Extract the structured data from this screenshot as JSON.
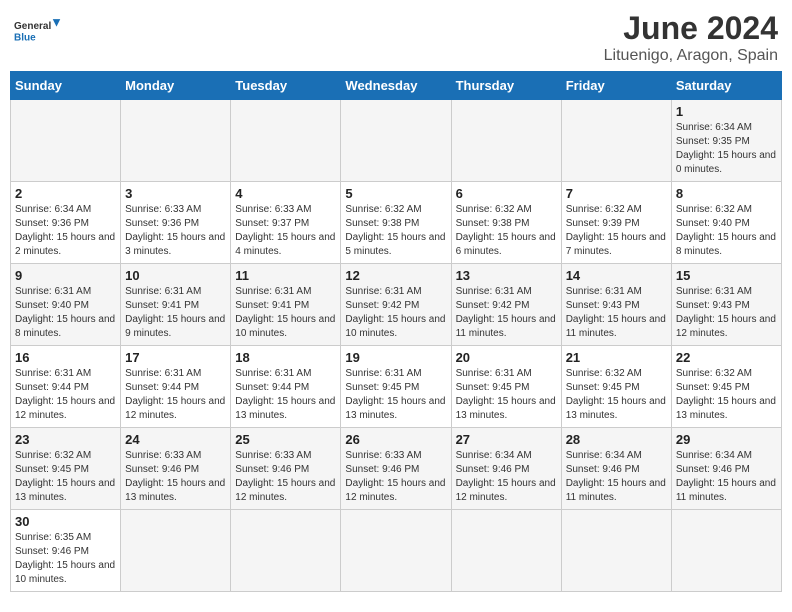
{
  "header": {
    "logo_general": "General",
    "logo_blue": "Blue",
    "title": "June 2024",
    "location": "Lituenigo, Aragon, Spain"
  },
  "days_of_week": [
    "Sunday",
    "Monday",
    "Tuesday",
    "Wednesday",
    "Thursday",
    "Friday",
    "Saturday"
  ],
  "weeks": [
    [
      {
        "day": "",
        "info": ""
      },
      {
        "day": "",
        "info": ""
      },
      {
        "day": "",
        "info": ""
      },
      {
        "day": "",
        "info": ""
      },
      {
        "day": "",
        "info": ""
      },
      {
        "day": "",
        "info": ""
      },
      {
        "day": "1",
        "info": "Sunrise: 6:34 AM\nSunset: 9:35 PM\nDaylight: 15 hours\nand 0 minutes."
      }
    ],
    [
      {
        "day": "2",
        "info": "Sunrise: 6:34 AM\nSunset: 9:36 PM\nDaylight: 15 hours\nand 2 minutes."
      },
      {
        "day": "3",
        "info": "Sunrise: 6:33 AM\nSunset: 9:36 PM\nDaylight: 15 hours\nand 3 minutes."
      },
      {
        "day": "4",
        "info": "Sunrise: 6:33 AM\nSunset: 9:37 PM\nDaylight: 15 hours\nand 4 minutes."
      },
      {
        "day": "5",
        "info": "Sunrise: 6:32 AM\nSunset: 9:38 PM\nDaylight: 15 hours\nand 5 minutes."
      },
      {
        "day": "6",
        "info": "Sunrise: 6:32 AM\nSunset: 9:38 PM\nDaylight: 15 hours\nand 6 minutes."
      },
      {
        "day": "7",
        "info": "Sunrise: 6:32 AM\nSunset: 9:39 PM\nDaylight: 15 hours\nand 7 minutes."
      },
      {
        "day": "8",
        "info": "Sunrise: 6:32 AM\nSunset: 9:40 PM\nDaylight: 15 hours\nand 8 minutes."
      }
    ],
    [
      {
        "day": "9",
        "info": "Sunrise: 6:31 AM\nSunset: 9:40 PM\nDaylight: 15 hours\nand 8 minutes."
      },
      {
        "day": "10",
        "info": "Sunrise: 6:31 AM\nSunset: 9:41 PM\nDaylight: 15 hours\nand 9 minutes."
      },
      {
        "day": "11",
        "info": "Sunrise: 6:31 AM\nSunset: 9:41 PM\nDaylight: 15 hours\nand 10 minutes."
      },
      {
        "day": "12",
        "info": "Sunrise: 6:31 AM\nSunset: 9:42 PM\nDaylight: 15 hours\nand 10 minutes."
      },
      {
        "day": "13",
        "info": "Sunrise: 6:31 AM\nSunset: 9:42 PM\nDaylight: 15 hours\nand 11 minutes."
      },
      {
        "day": "14",
        "info": "Sunrise: 6:31 AM\nSunset: 9:43 PM\nDaylight: 15 hours\nand 11 minutes."
      },
      {
        "day": "15",
        "info": "Sunrise: 6:31 AM\nSunset: 9:43 PM\nDaylight: 15 hours\nand 12 minutes."
      }
    ],
    [
      {
        "day": "16",
        "info": "Sunrise: 6:31 AM\nSunset: 9:44 PM\nDaylight: 15 hours\nand 12 minutes."
      },
      {
        "day": "17",
        "info": "Sunrise: 6:31 AM\nSunset: 9:44 PM\nDaylight: 15 hours\nand 12 minutes."
      },
      {
        "day": "18",
        "info": "Sunrise: 6:31 AM\nSunset: 9:44 PM\nDaylight: 15 hours\nand 13 minutes."
      },
      {
        "day": "19",
        "info": "Sunrise: 6:31 AM\nSunset: 9:45 PM\nDaylight: 15 hours\nand 13 minutes."
      },
      {
        "day": "20",
        "info": "Sunrise: 6:31 AM\nSunset: 9:45 PM\nDaylight: 15 hours\nand 13 minutes."
      },
      {
        "day": "21",
        "info": "Sunrise: 6:32 AM\nSunset: 9:45 PM\nDaylight: 15 hours\nand 13 minutes."
      },
      {
        "day": "22",
        "info": "Sunrise: 6:32 AM\nSunset: 9:45 PM\nDaylight: 15 hours\nand 13 minutes."
      }
    ],
    [
      {
        "day": "23",
        "info": "Sunrise: 6:32 AM\nSunset: 9:45 PM\nDaylight: 15 hours\nand 13 minutes."
      },
      {
        "day": "24",
        "info": "Sunrise: 6:33 AM\nSunset: 9:46 PM\nDaylight: 15 hours\nand 13 minutes."
      },
      {
        "day": "25",
        "info": "Sunrise: 6:33 AM\nSunset: 9:46 PM\nDaylight: 15 hours\nand 12 minutes."
      },
      {
        "day": "26",
        "info": "Sunrise: 6:33 AM\nSunset: 9:46 PM\nDaylight: 15 hours\nand 12 minutes."
      },
      {
        "day": "27",
        "info": "Sunrise: 6:34 AM\nSunset: 9:46 PM\nDaylight: 15 hours\nand 12 minutes."
      },
      {
        "day": "28",
        "info": "Sunrise: 6:34 AM\nSunset: 9:46 PM\nDaylight: 15 hours\nand 11 minutes."
      },
      {
        "day": "29",
        "info": "Sunrise: 6:34 AM\nSunset: 9:46 PM\nDaylight: 15 hours\nand 11 minutes."
      }
    ],
    [
      {
        "day": "30",
        "info": "Sunrise: 6:35 AM\nSunset: 9:46 PM\nDaylight: 15 hours\nand 10 minutes."
      },
      {
        "day": "",
        "info": ""
      },
      {
        "day": "",
        "info": ""
      },
      {
        "day": "",
        "info": ""
      },
      {
        "day": "",
        "info": ""
      },
      {
        "day": "",
        "info": ""
      },
      {
        "day": "",
        "info": ""
      }
    ]
  ]
}
